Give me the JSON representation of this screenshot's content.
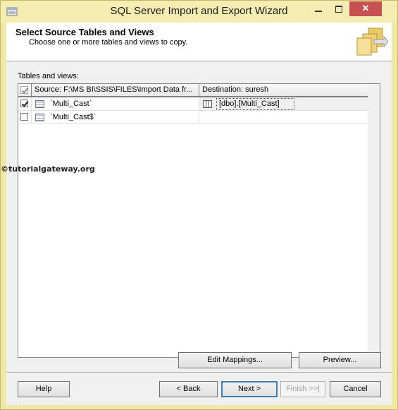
{
  "window": {
    "title": "SQL Server Import and Export Wizard"
  },
  "header": {
    "title": "Select Source Tables and Views",
    "subtitle": "Choose one or more tables and views to copy."
  },
  "section_label": "Tables and views:",
  "grid": {
    "columns": {
      "source": "Source: F:\\MS BI\\SSIS\\FILES\\Import Data fr...",
      "destination": "Destination: suresh"
    },
    "rows": [
      {
        "checked": true,
        "source": "`Multi_Cast`",
        "destination": "[dbo].[Multi_Cast]"
      },
      {
        "checked": false,
        "source": "`Multi_Cast$`",
        "destination": ""
      }
    ]
  },
  "watermark": "©tutorialgateway.org",
  "buttons": {
    "edit_mappings": "Edit Mappings...",
    "preview": "Preview...",
    "help": "Help",
    "back": "< Back",
    "next": "Next >",
    "finish": "Finish >>|",
    "cancel": "Cancel"
  },
  "colors": {
    "window_frame": "#f0e8a8",
    "close_button": "#c75050",
    "focus_border": "#3c7fb1"
  }
}
